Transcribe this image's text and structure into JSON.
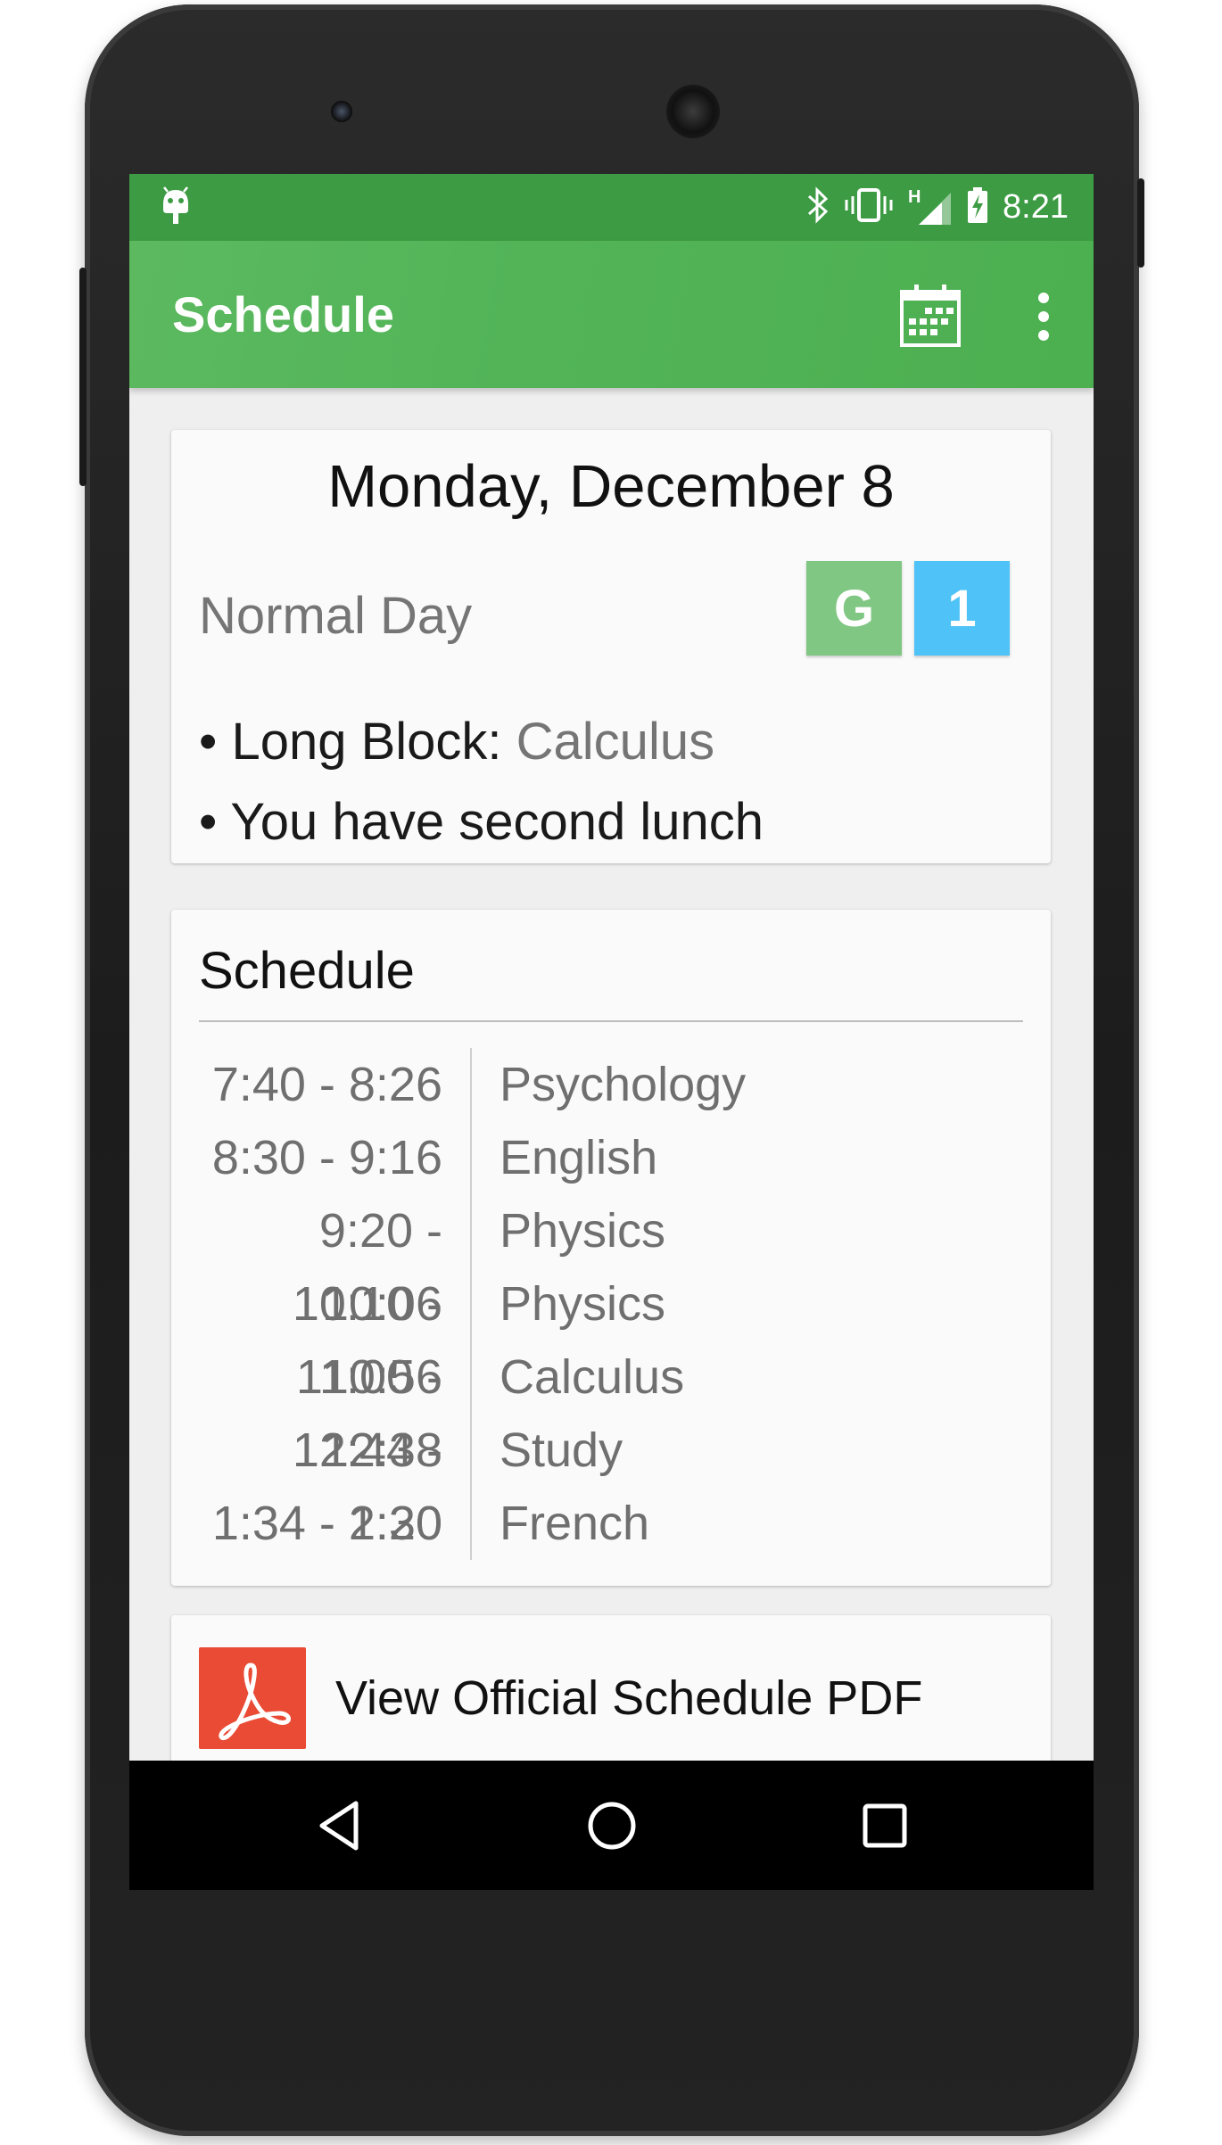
{
  "status_bar": {
    "time": "8:21",
    "network_label": "H",
    "icons": [
      "android-icon",
      "bluetooth-icon",
      "vibrate-icon",
      "signal-icon",
      "battery-charging-icon"
    ]
  },
  "app_bar": {
    "title": "Schedule",
    "actions": [
      "calendar-icon",
      "more-vert-icon"
    ],
    "color": "#4caf50"
  },
  "day_card": {
    "date": "Monday, December 8",
    "day_type": "Normal Day",
    "badges": [
      {
        "label": "G",
        "color": "#81c784"
      },
      {
        "label": "1",
        "color": "#4fc3f7"
      }
    ],
    "bullet_marker": "•",
    "long_block_label": "Long Block:",
    "long_block_value": "Calculus",
    "lunch_note": "You have second lunch"
  },
  "schedule_card": {
    "title": "Schedule",
    "rows": [
      {
        "time": "7:40 - 8:26",
        "class": "Psychology"
      },
      {
        "time": "8:30 - 9:16",
        "class": "English"
      },
      {
        "time": "9:20 - 10:06",
        "class": "Physics"
      },
      {
        "time": "10:10 - 10:56",
        "class": "Physics"
      },
      {
        "time": "11:00 - 12:38",
        "class": "Calculus"
      },
      {
        "time": "12:44 - 1:30",
        "class": "Study"
      },
      {
        "time": "1:34 - 2:20",
        "class": "French"
      }
    ]
  },
  "pdf_card": {
    "label": "View Official Schedule PDF",
    "icon": "acrobat-icon",
    "color": "#e94b35"
  },
  "nav_bar": {
    "buttons": [
      "back-icon",
      "home-icon",
      "recents-icon"
    ]
  }
}
